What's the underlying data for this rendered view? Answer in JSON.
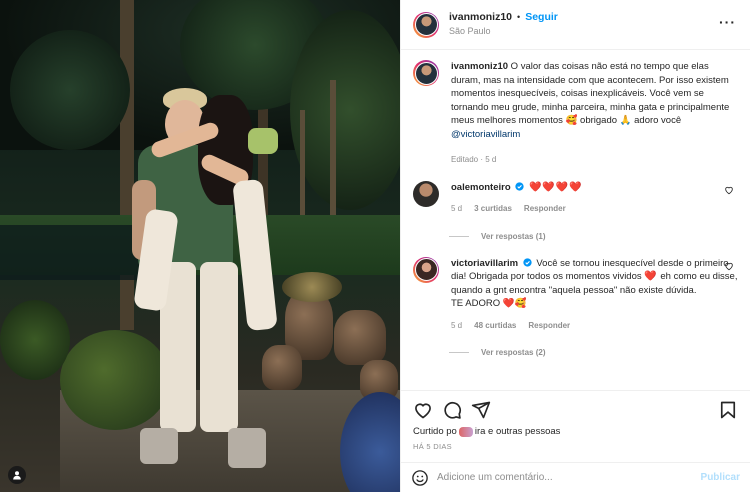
{
  "post": {
    "username": "ivanmoniz10",
    "follow_label": "Seguir",
    "separator": "•",
    "location": "São Paulo",
    "caption": "O valor das coisas não está no tempo que elas duram, mas na intensidade com que acontecem. Por isso existem momentos inesquecíveis, coisas inexplicáveis. Você vem se tornando meu grude, minha parceira, minha gata e principalmente meus melhores momentos 🥰 obrigado 🙏 adoro você",
    "caption_mention": "@victoriavillarim",
    "edited": "Editado · 5 d"
  },
  "comments": [
    {
      "username": "oalemonteiro",
      "verified": true,
      "text": "❤️❤️❤️❤️",
      "age": "5 d",
      "likes": "3 curtidas",
      "reply_label": "Responder",
      "view_replies": "Ver respostas (1)"
    },
    {
      "username": "victoriavillarim",
      "verified": true,
      "text_part1": "Você se tornou inesquecível desde o primeiro dia! Obrigada por todos os momentos vividos",
      "text_heart": "❤️",
      "text_part2": "eh como eu disse, quando a gnt encontra \"aquela pessoa\" não existe dúvida.",
      "text_part3": "TE ADORO ❤️🥰",
      "age": "5 d",
      "likes": "48 curtidas",
      "reply_label": "Responder",
      "view_replies": "Ver respostas (2)"
    }
  ],
  "actions": {
    "liked_prefix": "Curtido po",
    "liked_suffix": "ira e outras pessoas",
    "date": "HÁ 5 DIAS"
  },
  "add_comment": {
    "placeholder": "Adicione um comentário...",
    "publish_label": "Publicar"
  },
  "icons": {
    "more": "more-options-icon",
    "heart": "heart-icon",
    "comment": "comment-icon",
    "share": "share-icon",
    "save": "bookmark-icon",
    "emoji": "emoji-icon",
    "user": "user-tag-icon",
    "verified": "verified-badge-icon"
  },
  "colors": {
    "accent": "#0095f6",
    "secondary_text": "#8e8e8e",
    "heart_red": "#ed4956",
    "publish_disabled": "#b2dffc"
  }
}
